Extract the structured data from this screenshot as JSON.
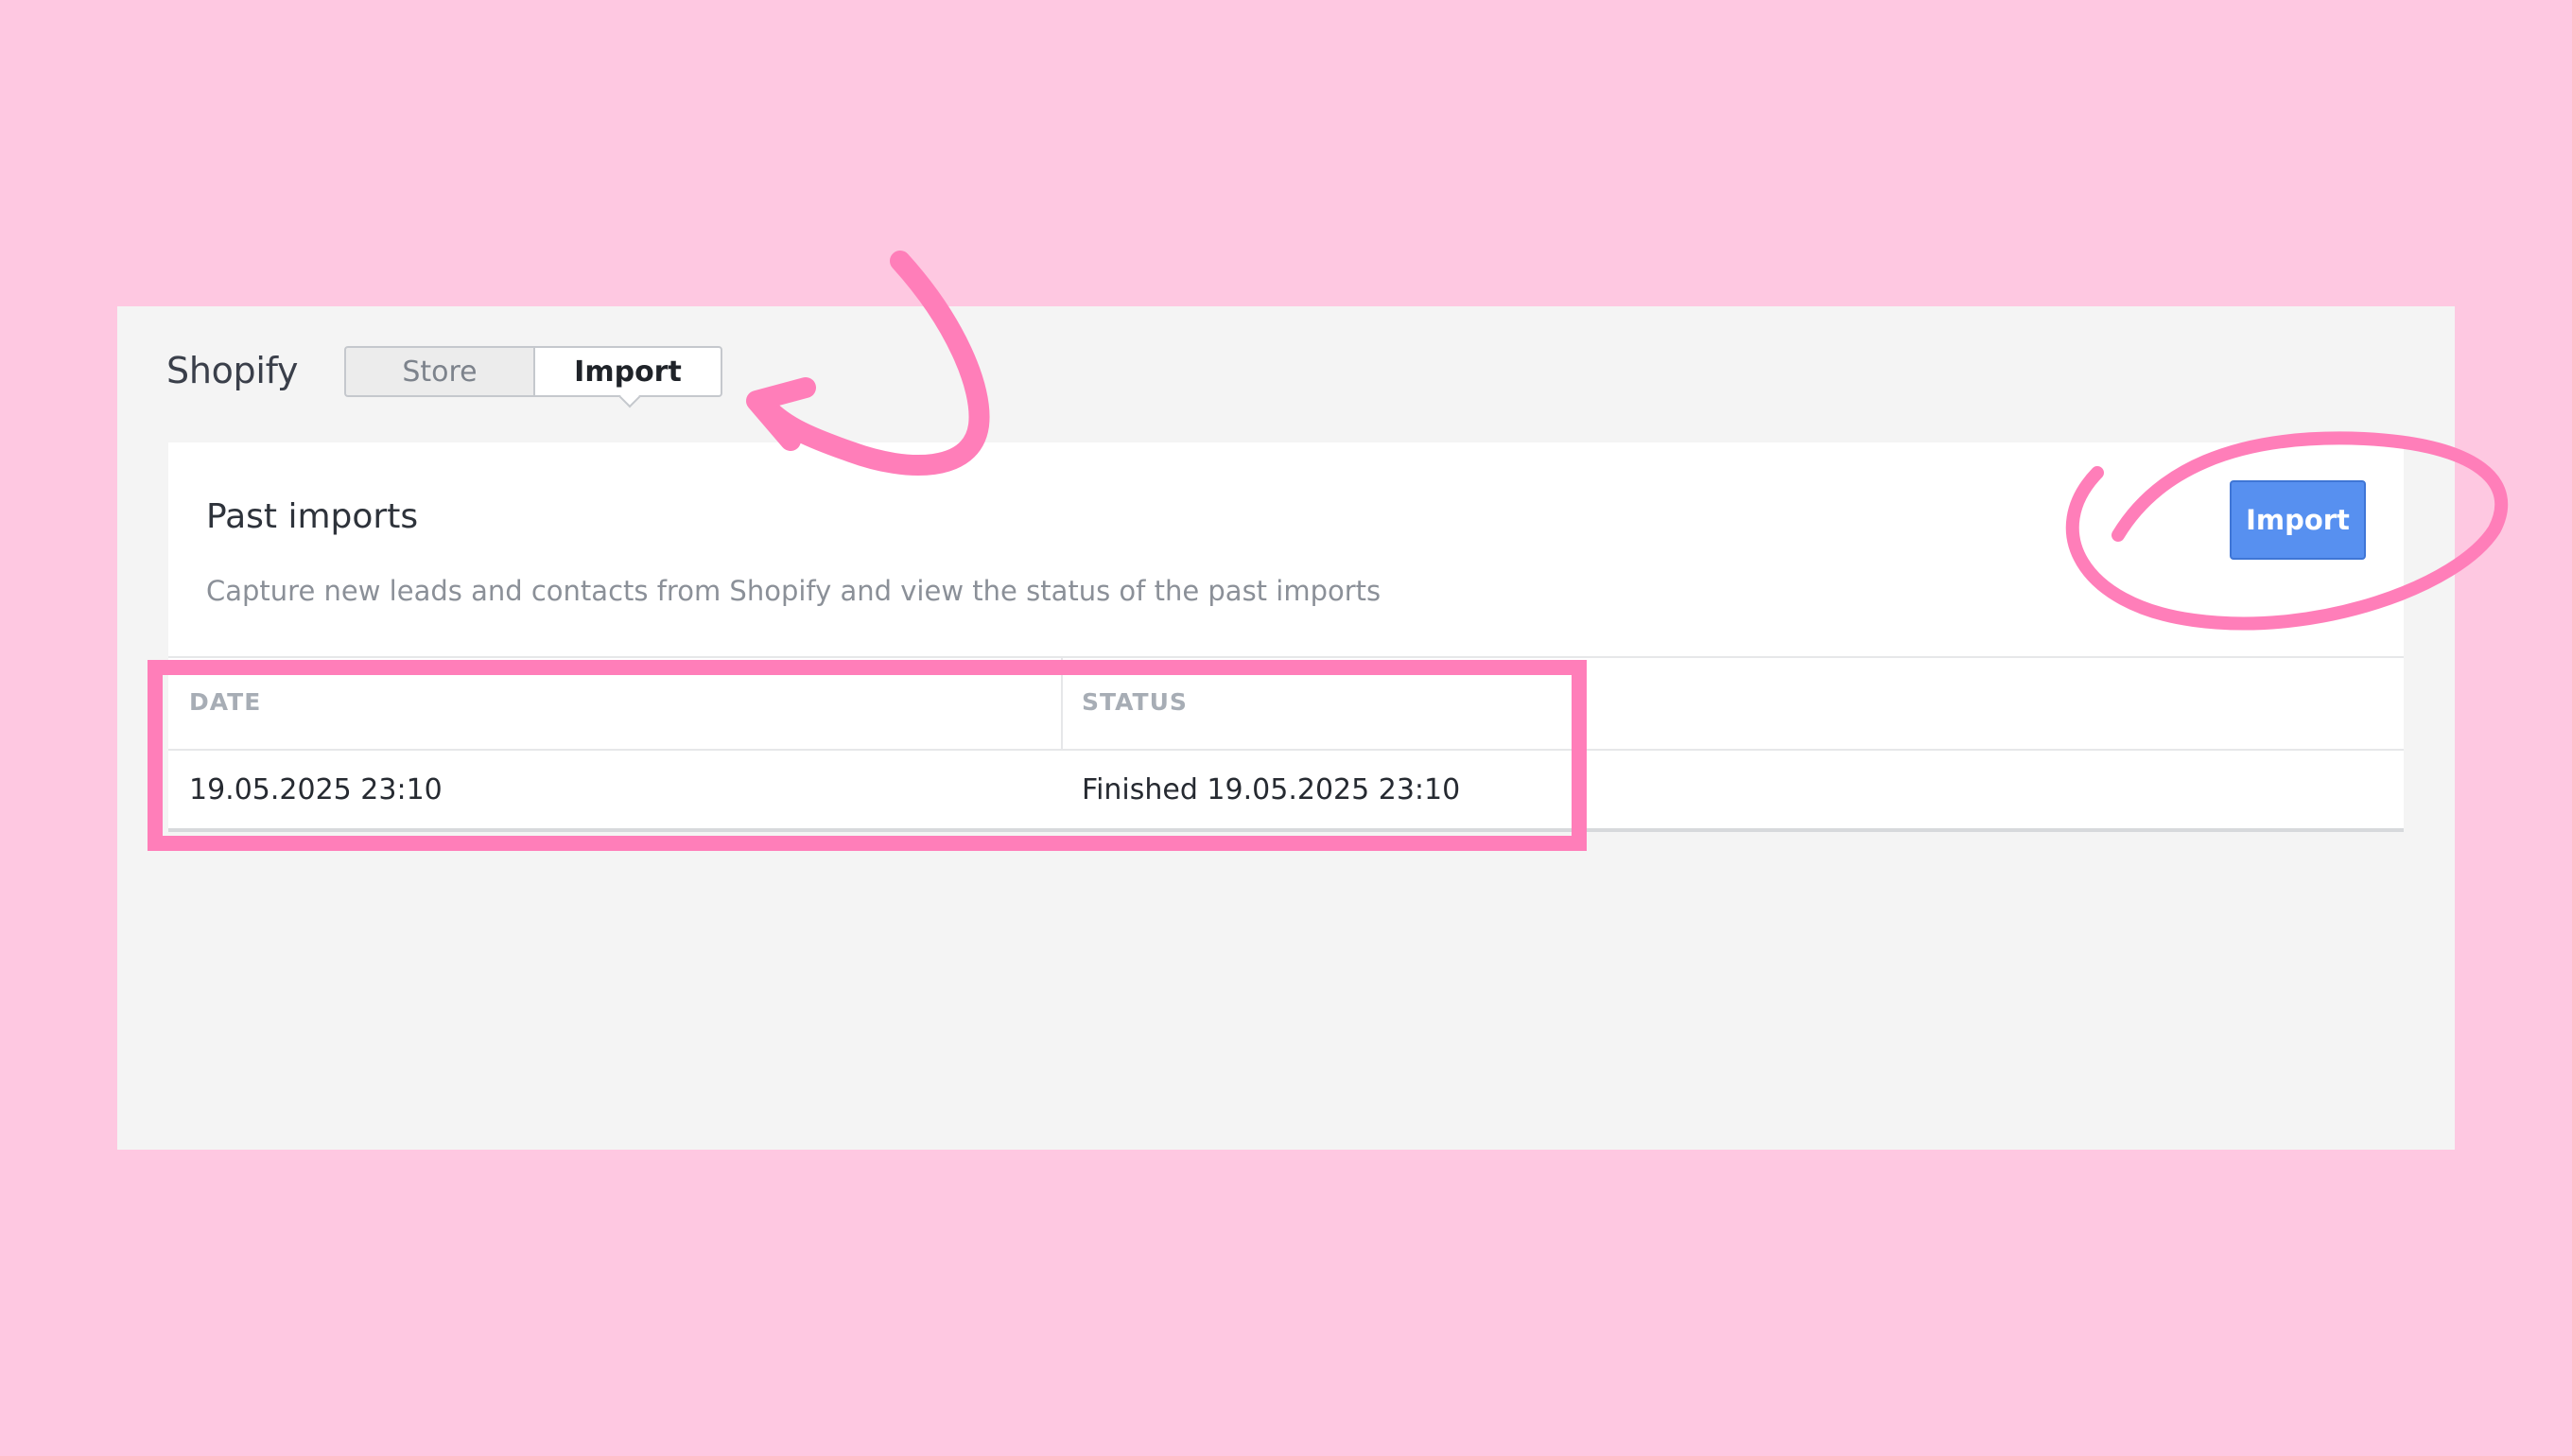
{
  "app": {
    "title": "Shopify"
  },
  "tabs": [
    {
      "label": "Store",
      "active": false
    },
    {
      "label": "Import",
      "active": true
    }
  ],
  "card": {
    "title": "Past imports",
    "description": "Capture new leads and contacts from Shopify and view the status of the past imports",
    "import_button_label": "Import"
  },
  "table": {
    "columns": [
      "DATE",
      "STATUS"
    ],
    "rows": [
      {
        "date": "19.05.2025 23:10",
        "status": "Finished 19.05.2025 23:10"
      }
    ]
  },
  "colors": {
    "background": "#fec8e1",
    "annotation": "#ff7eb9",
    "button": "#5790f0"
  }
}
